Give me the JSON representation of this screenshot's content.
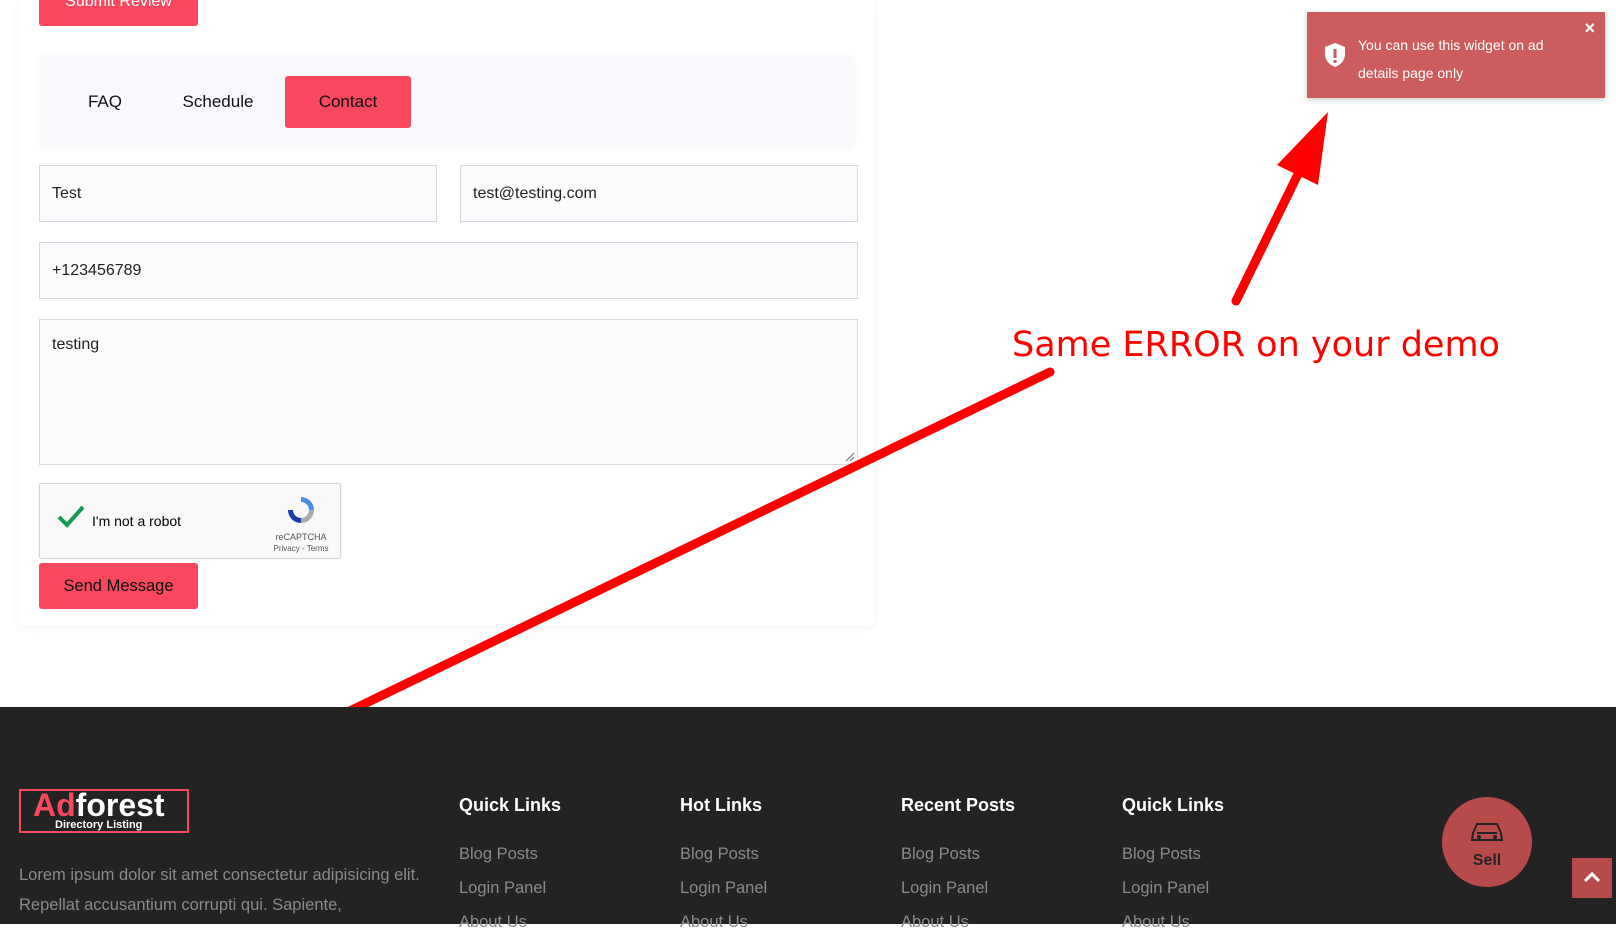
{
  "top_button": {
    "label": "Submit Review"
  },
  "tabs": [
    {
      "label": "FAQ",
      "active": false
    },
    {
      "label": "Schedule",
      "active": false
    },
    {
      "label": "Contact",
      "active": true
    }
  ],
  "form": {
    "name_value": "Test",
    "email_value": "test@testing.com",
    "phone_value": "+123456789",
    "message_value": "testing",
    "send_label": "Send Message"
  },
  "recaptcha": {
    "label": "I'm not a robot",
    "brand": "reCAPTCHA",
    "links": "Privacy - Terms",
    "checked": true
  },
  "toast": {
    "message": "You can use this widget on ad details page only",
    "close": "×",
    "icon": "shield-alert-icon"
  },
  "annotation": {
    "text": "Same ERROR on your demo",
    "color": "#ff0000"
  },
  "footer": {
    "logo": {
      "ad": "Ad",
      "forest": "forest",
      "tagline": "Directory Listing"
    },
    "about": "Lorem ipsum dolor sit amet consectetur adipisicing elit. Repellat accusantium corrupti qui. Sapiente,",
    "columns": [
      {
        "title": "Quick Links",
        "links": [
          "Blog Posts",
          "Login Panel",
          "About Us"
        ]
      },
      {
        "title": "Hot Links",
        "links": [
          "Blog Posts",
          "Login Panel",
          "About Us"
        ]
      },
      {
        "title": "Recent Posts",
        "links": [
          "Blog Posts",
          "Login Panel",
          "About Us"
        ]
      },
      {
        "title": "Quick Links",
        "links": [
          "Blog Posts",
          "Login Panel",
          "About Us"
        ]
      }
    ],
    "sell_label": "Sell",
    "scroll_top_icon": "chevron-up-icon"
  },
  "colors": {
    "accent": "#f9485d",
    "toast": "#cd5c5c",
    "footer_bg": "#232323"
  }
}
